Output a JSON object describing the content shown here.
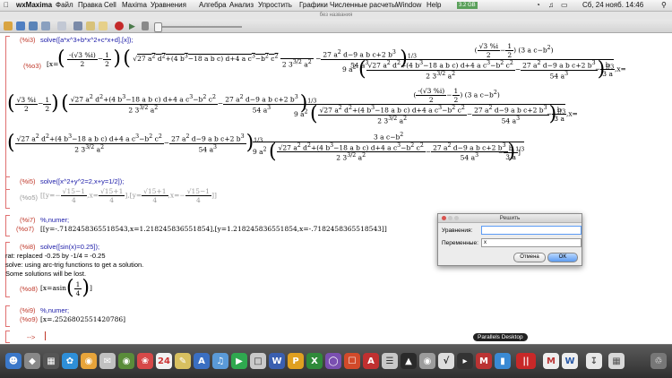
{
  "menubar": {
    "app": "wxMaxima",
    "items": [
      "Файл",
      "Правка",
      "Cell",
      "Maxima",
      "Уравнения",
      "Алгебра",
      "Анализ",
      "Упростить",
      "Графики",
      "Численные расчеты",
      "Window",
      "Help"
    ],
    "battery": "3.2 GB",
    "clock": "Сб, 24 нояб. 14:46"
  },
  "window": {
    "title": "без названия"
  },
  "cells": {
    "i3": {
      "label": "(%i3)",
      "input": "solve([a*x^3+b*x^2+c*x+d],[x]);"
    },
    "o3": {
      "label": "(%o3)",
      "lead": "[x="
    },
    "i5": {
      "label": "(%i5)",
      "input": "solve([x^2+y^2=2,x+y=1/2]);"
    },
    "o5": {
      "label": "(%o5)"
    },
    "i7": {
      "label": "(%i7)",
      "input": "%,numer;"
    },
    "o7": {
      "label": "(%o7)",
      "output": "[[y=-.7182458365518543,x=1.218245836551854],[y=1.218245836551854,x=-.7182458365518543]]"
    },
    "i8": {
      "label": "(%i8)",
      "input": "solve([sin(x)=0.25]);"
    },
    "msg": {
      "line1": "rat: replaced -0.25 by -1/4 = -0.25",
      "line2": "solve: using arc-trig functions to get a solution.",
      "line3": "Some solutions will be lost."
    },
    "o8": {
      "label": "(%o8)",
      "output": "[x=asin(1/4)]"
    },
    "i9": {
      "label": "(%i9)",
      "input": "%,numer;"
    },
    "o9": {
      "label": "(%o9)",
      "output": "[x=.2526802551420786]"
    },
    "prompt": "-->"
  },
  "dialog": {
    "title": "Решить",
    "equations_label": "Уравнения:",
    "equations_value": "",
    "variables_label": "Переменные:",
    "variables_value": "x",
    "cancel": "Отмена",
    "ok": "OK"
  },
  "dock": {
    "tooltip": "Parallels Desktop"
  },
  "colors": {
    "label": "#c0392b",
    "input": "#1a1aa8",
    "bracket": "#e07070",
    "accent": "#3b82f6"
  }
}
